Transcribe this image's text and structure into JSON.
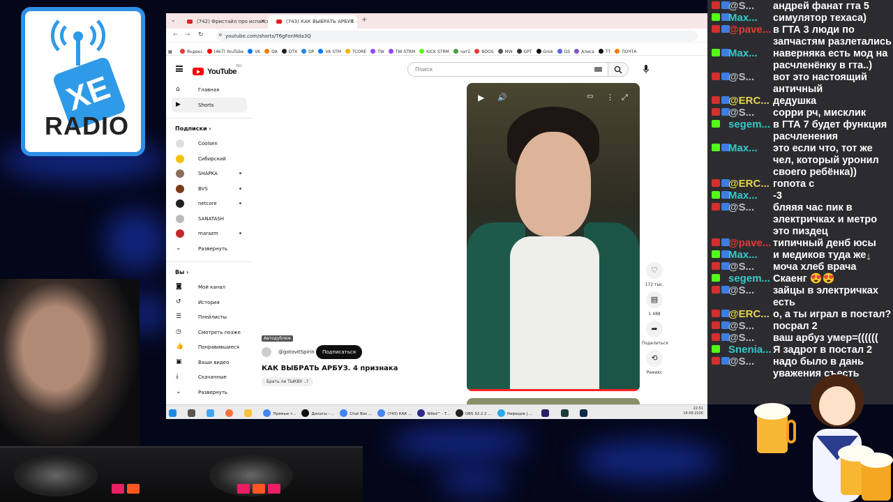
{
  "browser": {
    "tabs": [
      {
        "title": "(742) Фристайл про испанск",
        "active": false
      },
      {
        "title": "(743) КАК ВЫБРАТЬ АРБУЗ. 4",
        "active": true
      }
    ],
    "new_tab": "+",
    "url": "youtube.com/shorts/T6gFonMda3Q",
    "bookmarks": [
      {
        "label": "Яндекс",
        "color": "#e53935"
      },
      {
        "label": "(467) YouTube",
        "color": "#ff0000"
      },
      {
        "label": "VK",
        "color": "#0077ff"
      },
      {
        "label": "DA",
        "color": "#f57c00"
      },
      {
        "label": "DTX",
        "color": "#222222"
      },
      {
        "label": "DP",
        "color": "#1e88e5"
      },
      {
        "label": "VK STM",
        "color": "#0077ff"
      },
      {
        "label": "TCORE",
        "color": "#f4b400"
      },
      {
        "label": "TW",
        "color": "#9146ff"
      },
      {
        "label": "TW STRM",
        "color": "#9146ff"
      },
      {
        "label": "KICK STRM",
        "color": "#53fc18"
      },
      {
        "label": "чат2",
        "color": "#43a047"
      },
      {
        "label": "BOOS",
        "color": "#e53935"
      },
      {
        "label": "MW",
        "color": "#555555"
      },
      {
        "label": "GPT",
        "color": "#333333"
      },
      {
        "label": "Grok",
        "color": "#111111"
      },
      {
        "label": "DS",
        "color": "#5865f2"
      },
      {
        "label": "Алиса",
        "color": "#7e57c2"
      },
      {
        "label": "TT",
        "color": "#111111"
      },
      {
        "label": "ПОЧТА",
        "color": "#f57c00"
      }
    ]
  },
  "youtube": {
    "logo_word": "YouTube",
    "logo_region": "RU",
    "search_placeholder": "Поиск",
    "sidebar_main": [
      {
        "label": "Главная",
        "icon": "home-icon",
        "active": false
      },
      {
        "label": "Shorts",
        "icon": "shorts-icon",
        "active": true
      }
    ],
    "subscriptions_header": "Подписки",
    "subscriptions": [
      {
        "label": "Coolsen",
        "color": "#dddddd",
        "dot": false
      },
      {
        "label": "Сибирский",
        "color": "#f4c20d",
        "dot": false
      },
      {
        "label": "SHAPKA",
        "color": "#8a6d5c",
        "dot": true
      },
      {
        "label": "BVS",
        "color": "#7a3a1a",
        "dot": true
      },
      {
        "label": "netcore",
        "color": "#222222",
        "dot": true
      },
      {
        "label": "SANATASH",
        "color": "#bbbbbb",
        "dot": false
      },
      {
        "label": "marazm",
        "color": "#c62828",
        "dot": true
      }
    ],
    "expand_label": "Развернуть",
    "you_header": "Вы",
    "you_items": [
      {
        "label": "Мой канал",
        "icon": "channel-icon"
      },
      {
        "label": "История",
        "icon": "history-icon"
      },
      {
        "label": "Плейлисты",
        "icon": "playlist-icon"
      },
      {
        "label": "Смотреть позже",
        "icon": "clock-icon"
      },
      {
        "label": "Понравившиеся",
        "icon": "like-icon"
      },
      {
        "label": "Ваши видео",
        "icon": "video-icon"
      },
      {
        "label": "Скачанные",
        "icon": "download-icon"
      },
      {
        "label": "Развернуть",
        "icon": "chevron-down-icon"
      }
    ],
    "short": {
      "dub_badge": "Автодубляж",
      "channel": "@gotovitSpirin",
      "subscribe_label": "Подписаться",
      "title": "КАК ВЫБРАТЬ АРБУЗ. 4 признака",
      "chip": "Брать ли ТЫКВУ ..?"
    },
    "actions": [
      {
        "icon": "like-icon",
        "glyph": "♡",
        "label": "172 тыс."
      },
      {
        "icon": "comment-icon",
        "glyph": "▤",
        "label": "1 488"
      },
      {
        "icon": "share-icon",
        "glyph": "➦",
        "label": "Поделиться"
      },
      {
        "icon": "remix-icon",
        "glyph": "⟲",
        "label": "Ремикс"
      }
    ]
  },
  "taskbar": {
    "items": [
      {
        "label": "Прямые т...",
        "color": "#4285f4"
      },
      {
        "label": "Донаты - ...",
        "color": "#111111"
      },
      {
        "label": "Chat Box ...",
        "color": "#4285f4"
      },
      {
        "label": "(743) КАК ...",
        "color": "#4285f4"
      },
      {
        "label": "Nifed^ - T...",
        "color": "#2b2b8c"
      },
      {
        "label": "OBS 32.2.2 ...",
        "color": "#222222"
      },
      {
        "label": "Нифедов | ...",
        "color": "#29a9eb"
      }
    ],
    "clock_time": "22:51",
    "clock_date": "18.08.2026"
  },
  "chat": [
    {
      "user": "@S...",
      "user_color": "#b9c0c9",
      "badges": [
        "#d32f2f",
        "#3d7de0"
      ],
      "text": "андрей фанат гта 5"
    },
    {
      "user": "Max...",
      "user_color": "#35c9c9",
      "badges": [
        "#53fc18",
        "#3d7de0"
      ],
      "text": "симулятор техаса)"
    },
    {
      "user": "@pave...",
      "user_color": "#e53935",
      "badges": [
        "#d32f2f",
        "#3d7de0"
      ],
      "text": "в ГТА 3 люди по запчастям разлетались"
    },
    {
      "user": "Max...",
      "user_color": "#35c9c9",
      "badges": [
        "#53fc18",
        "#3d7de0"
      ],
      "text": "наверняка есть мод на расчленёнку в гта..)"
    },
    {
      "user": "@S...",
      "user_color": "#b9c0c9",
      "badges": [
        "#d32f2f",
        "#3d7de0"
      ],
      "text": "вот это настоящий античный"
    },
    {
      "user": "@ERC...",
      "user_color": "#e8d44d",
      "badges": [
        "#d32f2f",
        "#3d7de0"
      ],
      "text": "дедушка"
    },
    {
      "user": "@S...",
      "user_color": "#b9c0c9",
      "badges": [
        "#d32f2f",
        "#3d7de0"
      ],
      "text": "сорри рч, мисклик"
    },
    {
      "user": "segem...",
      "user_color": "#35c9c9",
      "badges": [
        "#53fc18"
      ],
      "text": "в ГТА 7 будет функция расчленения"
    },
    {
      "user": "Max...",
      "user_color": "#35c9c9",
      "badges": [
        "#53fc18",
        "#3d7de0"
      ],
      "text": "это если что, тот же чел, который уронил своего ребёнка))"
    },
    {
      "user": "@ERC...",
      "user_color": "#e8d44d",
      "badges": [
        "#d32f2f",
        "#3d7de0"
      ],
      "text": "гопота с"
    },
    {
      "user": "Max...",
      "user_color": "#35c9c9",
      "badges": [
        "#53fc18",
        "#3d7de0"
      ],
      "text": "-3"
    },
    {
      "user": "@S...",
      "user_color": "#b9c0c9",
      "badges": [
        "#d32f2f",
        "#3d7de0"
      ],
      "text": "бляяя час пик в электричках и метро это пиздец"
    },
    {
      "user": "@pave...",
      "user_color": "#e53935",
      "badges": [
        "#d32f2f",
        "#3d7de0"
      ],
      "text": "типичный денб юсы"
    },
    {
      "user": "Max...",
      "user_color": "#35c9c9",
      "badges": [
        "#53fc18",
        "#3d7de0"
      ],
      "text": "и медиков туда же"
    },
    {
      "user": "@S...",
      "user_color": "#b9c0c9",
      "badges": [
        "#d32f2f",
        "#3d7de0"
      ],
      "text": "моча хлеб врача"
    },
    {
      "user": "segem...",
      "user_color": "#35c9c9",
      "badges": [
        "#53fc18"
      ],
      "text": "Скаенг 😍😍"
    },
    {
      "user": "@S...",
      "user_color": "#b9c0c9",
      "badges": [
        "#d32f2f",
        "#3d7de0"
      ],
      "text": "зайцы в электричках есть"
    },
    {
      "user": "@ERC...",
      "user_color": "#e8d44d",
      "badges": [
        "#d32f2f",
        "#3d7de0"
      ],
      "text": "о, а ты играл в постал?"
    },
    {
      "user": "@S...",
      "user_color": "#b9c0c9",
      "badges": [
        "#d32f2f",
        "#3d7de0"
      ],
      "text": "посрал 2"
    },
    {
      "user": "@S...",
      "user_color": "#b9c0c9",
      "badges": [
        "#d32f2f",
        "#3d7de0"
      ],
      "text": "ваш арбуз умер=(((((("
    },
    {
      "user": "Snenia...",
      "user_color": "#35c9c9",
      "badges": [
        "#53fc18"
      ],
      "text": "Я задрот в постал 2"
    },
    {
      "user": "@S...",
      "user_color": "#b9c0c9",
      "badges": [
        "#d32f2f",
        "#3d7de0"
      ],
      "text": "надо было в дань уважения съесть"
    }
  ],
  "overlay": {
    "radio_logo_mark": "XE",
    "radio_logo_word": "RADIO"
  }
}
